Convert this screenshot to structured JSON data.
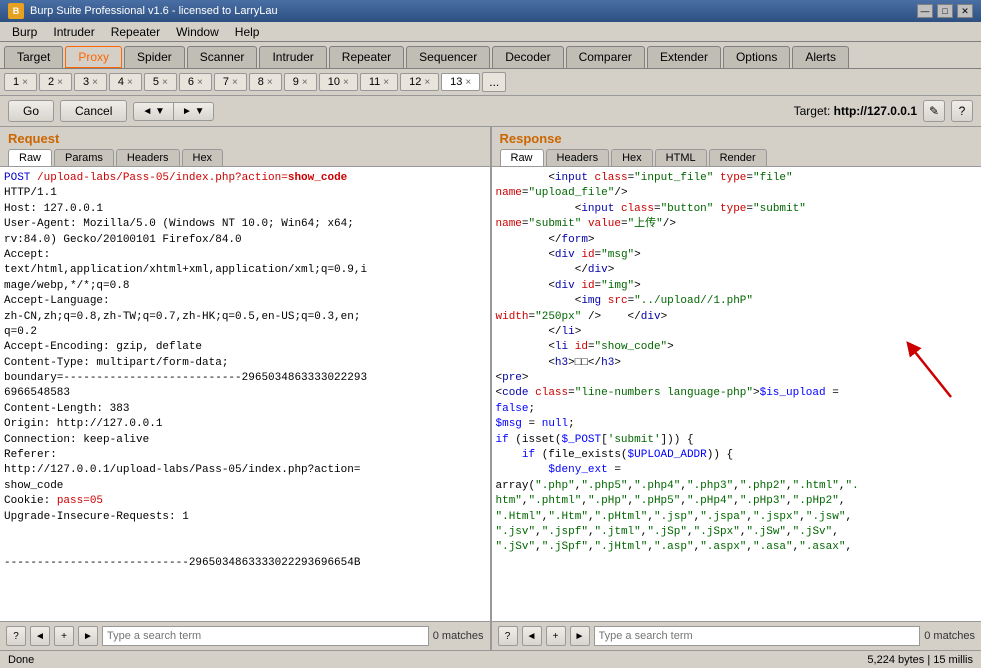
{
  "titlebar": {
    "icon_label": "B",
    "title": "Burp Suite Professional v1.6 - licensed to LarryLau",
    "minimize": "—",
    "maximize": "□",
    "close": "✕"
  },
  "menubar": {
    "items": [
      "Burp",
      "Intruder",
      "Repeater",
      "Window",
      "Help"
    ]
  },
  "navtabs": {
    "tabs": [
      {
        "label": "Target",
        "active": false,
        "highlight": false
      },
      {
        "label": "Proxy",
        "active": true,
        "highlight": true
      },
      {
        "label": "Spider",
        "active": false,
        "highlight": false
      },
      {
        "label": "Scanner",
        "active": false,
        "highlight": false
      },
      {
        "label": "Intruder",
        "active": false,
        "highlight": false
      },
      {
        "label": "Repeater",
        "active": false,
        "highlight": false
      },
      {
        "label": "Sequencer",
        "active": false,
        "highlight": false
      },
      {
        "label": "Decoder",
        "active": false,
        "highlight": false
      },
      {
        "label": "Comparer",
        "active": false,
        "highlight": false
      },
      {
        "label": "Extender",
        "active": false,
        "highlight": false
      },
      {
        "label": "Options",
        "active": false,
        "highlight": false
      },
      {
        "label": "Alerts",
        "active": false,
        "highlight": false
      }
    ]
  },
  "subtabs": {
    "tabs": [
      {
        "label": "1",
        "active": false
      },
      {
        "label": "2",
        "active": false
      },
      {
        "label": "3",
        "active": false
      },
      {
        "label": "4",
        "active": false
      },
      {
        "label": "5",
        "active": false
      },
      {
        "label": "6",
        "active": false
      },
      {
        "label": "7",
        "active": false
      },
      {
        "label": "8",
        "active": false
      },
      {
        "label": "9",
        "active": false
      },
      {
        "label": "10",
        "active": false
      },
      {
        "label": "11",
        "active": false
      },
      {
        "label": "12",
        "active": false
      },
      {
        "label": "13",
        "active": true
      }
    ],
    "more": "..."
  },
  "toolbar": {
    "go_label": "Go",
    "cancel_label": "Cancel",
    "back_label": "◄",
    "forward_label": "►",
    "target_prefix": "Target: ",
    "target_url": "http://127.0.0.1",
    "edit_icon": "✎",
    "help_icon": "?"
  },
  "request": {
    "panel_title": "Request",
    "tabs": [
      "Raw",
      "Params",
      "Headers",
      "Hex"
    ],
    "active_tab": "Raw",
    "content": "POST /upload-labs/Pass-05/index.php?action=show_code\nHTTP/1.1\nHost: 127.0.0.1\nUser-Agent: Mozilla/5.0 (Windows NT 10.0; Win64; x64;\nrv:84.0) Gecko/20100101 Firefox/84.0\nAccept:\ntext/html,application/xhtml+xml,application/xml;q=0.9,i\nmage/webp,*/*;q=0.8\nAccept-Language:\nzh-CN,zh;q=0.8,zh-TW;q=0.7,zh-HK;q=0.5,en-US;q=0.3,en;\nq=0.2\nAccept-Encoding: gzip, deflate\nContent-Type: multipart/form-data;\nboundary=---------------------------2965034863333022293\n6966548583\nContent-Length: 383\nOrigin: http://127.0.0.1\nConnection: keep-alive\nReferer:\nhttp://127.0.0.1/upload-labs/Pass-05/index.php?action=\nshow_code\nCookie: pass=05\nUpgrade-Insecure-Requests: 1\n\n\n----------------------------2965034863333022293696654B",
    "search_placeholder": "Type a search term",
    "matches": "0 matches"
  },
  "response": {
    "panel_title": "Response",
    "tabs": [
      "Raw",
      "Headers",
      "Hex",
      "HTML",
      "Render"
    ],
    "active_tab": "Raw",
    "content_lines": [
      "        <input class=\"input_file\" type=\"file\"",
      "name=\"upload_file\"/>",
      "            <input class=\"button\" type=\"submit\"",
      "name=\"submit\" value=\"上传\"/>",
      "        </form>",
      "        <div id=\"msg\">",
      "            </div>",
      "        <div id=\"img\">",
      "            <img src=\"../upload//1.phP\"",
      "width=\"250px\" />    </div>",
      "        </li>",
      "        <li id=\"show_code\">",
      "        <h3>□□</h3>",
      "<pre>",
      "<code class=\"line-numbers language-php\">$is_upload =",
      "false;",
      "$msg = null;",
      "if (isset($_POST['submit'])) {",
      "    if (file_exists($UPLOAD_ADDR)) {",
      "        $deny_ext =",
      "array(\".php\",\".php5\",\".php4\",\".php3\",\".php2\",\".html\",\".",
      "htm\",\".phtml\",\".php\",\".pHp5\",\".pHp4\",\".pHp3\",\".pHp2\",",
      "\".Html\",\".Htm\",\".pHtml\",\".jsp\",\".jspa\",\".jspx\",\".jsw\",",
      "\".jsv\",\".jspf\",\".jtml\",\".jSp\",\".jSpx\",\".jSw\",\".jSv\",",
      "\".jSv\",\".jSpf\",\".jHtml\",\".asp\",\".aspx\",\".asa\",\".asax\","
    ],
    "search_placeholder": "Type a search term",
    "matches": "0 matches"
  },
  "statusbar": {
    "left": "Done",
    "right": "5,224 bytes | 15 millis"
  }
}
